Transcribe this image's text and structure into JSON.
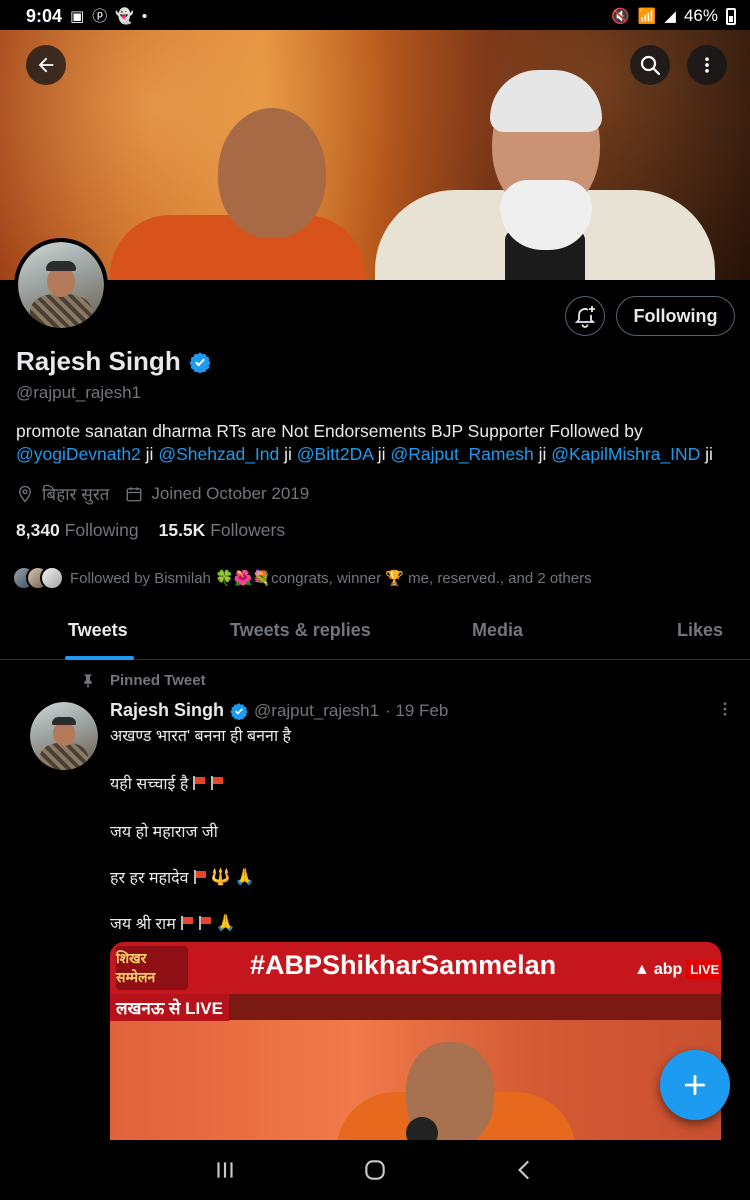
{
  "status_bar": {
    "time": "9:04",
    "battery": "46%"
  },
  "profile": {
    "name": "Rajesh Singh",
    "handle": "@rajput_rajesh1",
    "follow_button": "Following",
    "bio_text": "promote sanatan dharma RTs are Not Endorsements BJP Supporter Followed by",
    "bio_mentions": [
      "@yogiDevnath2",
      "@Shehzad_Ind",
      "@Bitt2DA",
      "@Rajput_Ramesh",
      "@KapilMishra_IND"
    ],
    "bio_suffix": "ji",
    "location": "बिहार सुरत",
    "joined": "Joined October 2019",
    "following_count": "8,340",
    "following_label": "Following",
    "followers_count": "15.5K",
    "followers_label": "Followers",
    "followed_by": "Followed by Bismilah 🍀🌺💐congrats, winner 🏆 me, reserved., and 2 others"
  },
  "tabs": [
    "Tweets",
    "Tweets & replies",
    "Media",
    "Likes"
  ],
  "tweet": {
    "pinned_label": "Pinned Tweet",
    "author": "Rajesh Singh",
    "handle": "@rajput_rajesh1",
    "date": "· 19 Feb",
    "lines": [
      "अखण्ड भारत' बनना ही बनना है",
      "यही सच्चाई है",
      "जय हो महाराज जी",
      "हर हर महादेव",
      "जय श्री राम"
    ],
    "media": {
      "logo": "शिखर सम्मेलन",
      "hashtag": "#ABPShikharSammelan",
      "channel": "abp",
      "live": "LIVE",
      "subtitle": "लखनऊ से LIVE"
    }
  },
  "colors": {
    "accent": "#1d9bf0",
    "muted": "#71767b",
    "text": "#e7e9ea"
  }
}
